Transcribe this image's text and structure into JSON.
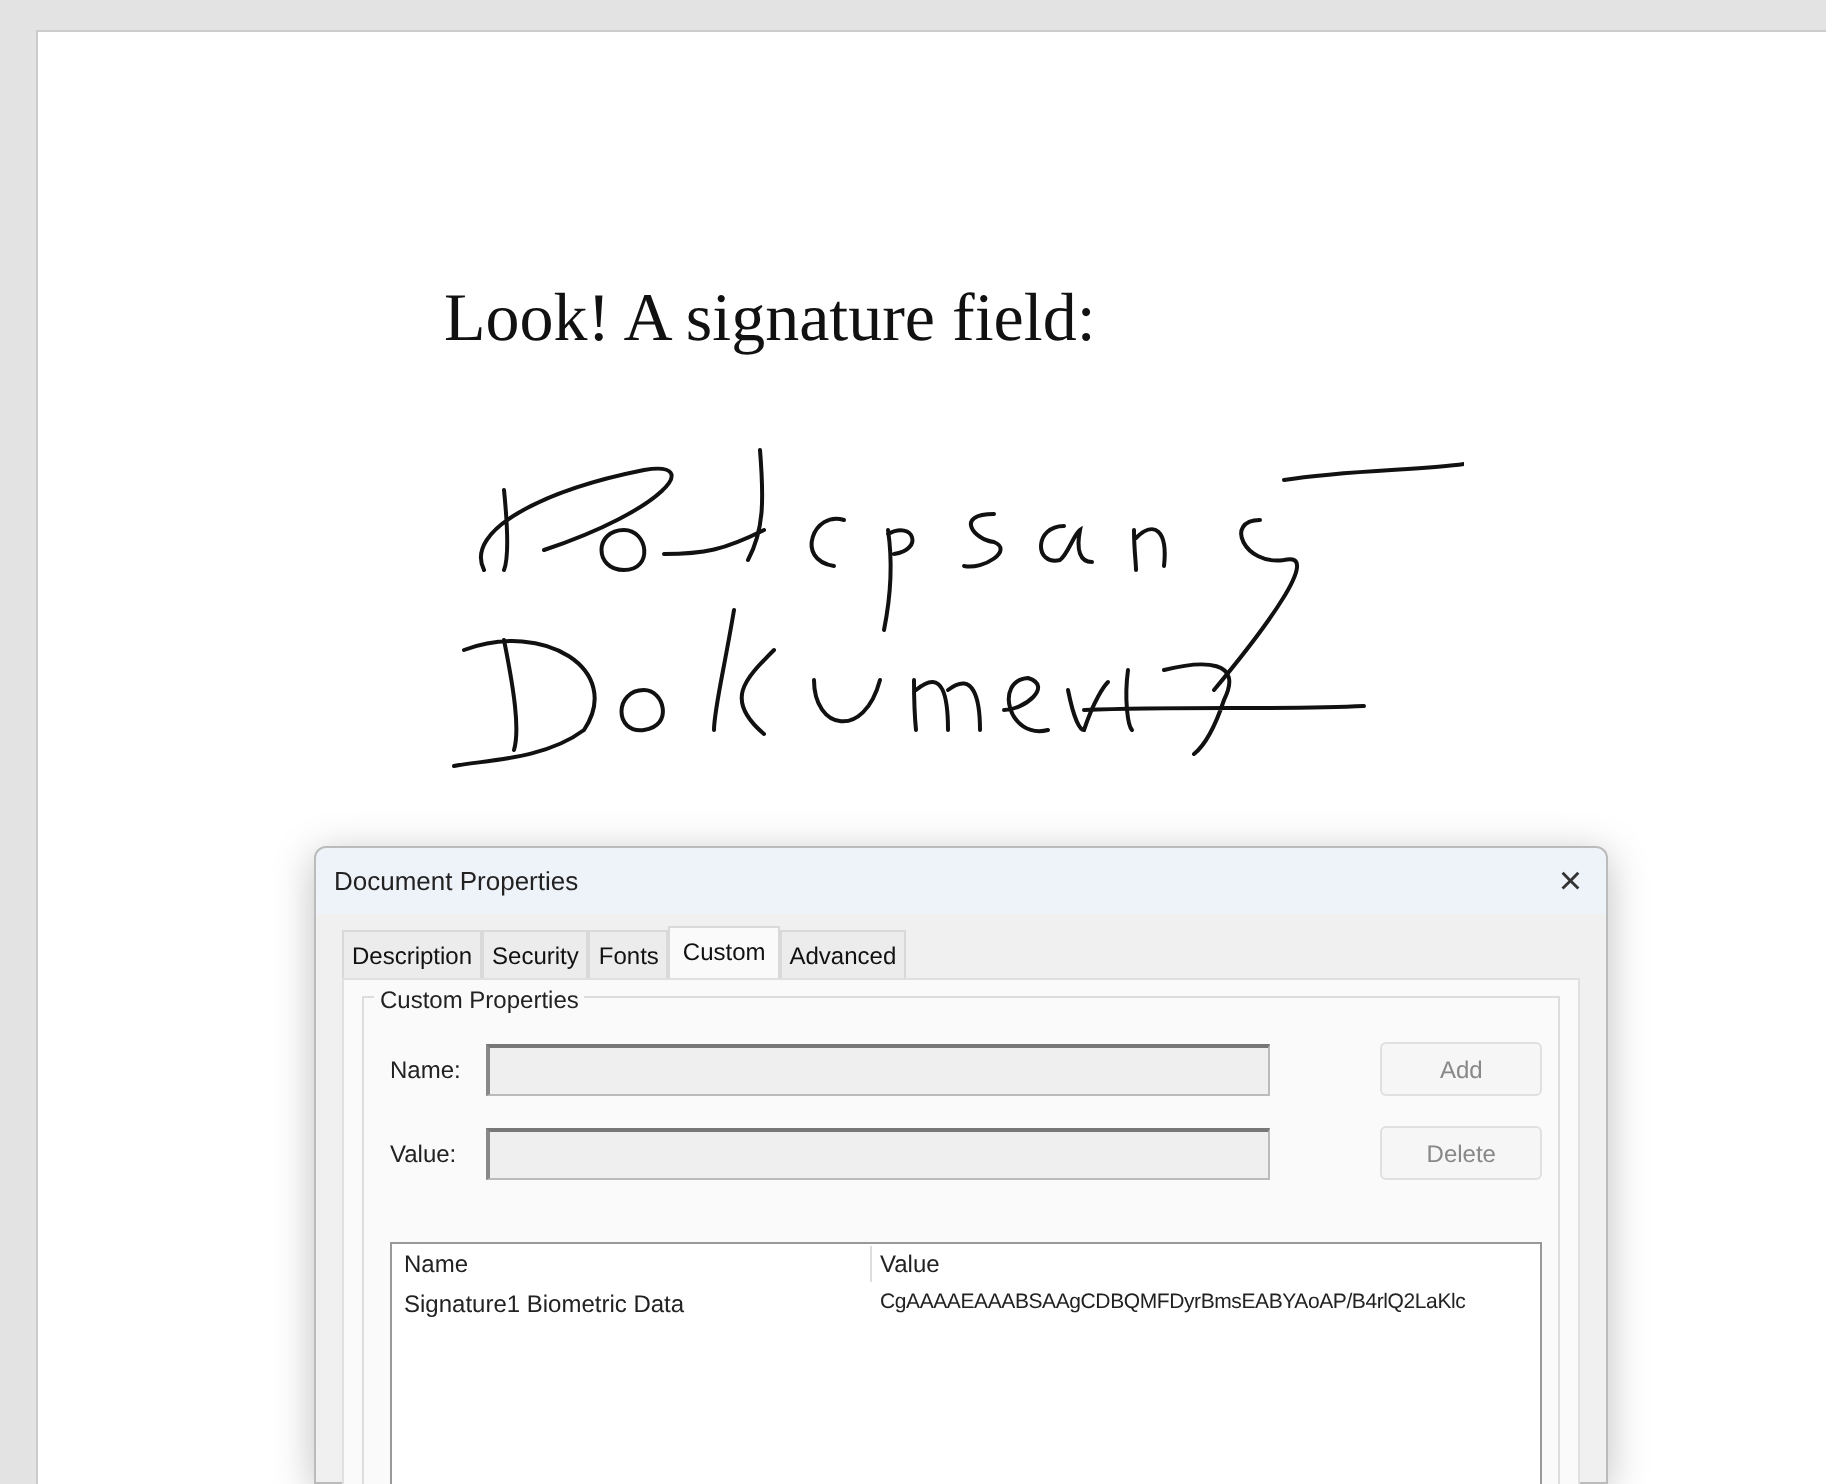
{
  "document": {
    "heading": "Look! A signature field:"
  },
  "dialog": {
    "title": "Document Properties",
    "close": "×",
    "tabs": [
      {
        "label": "Description",
        "selected": false
      },
      {
        "label": "Security",
        "selected": false
      },
      {
        "label": "Fonts",
        "selected": false
      },
      {
        "label": "Custom",
        "selected": true
      },
      {
        "label": "Advanced",
        "selected": false
      }
    ],
    "group_title": "Custom Properties",
    "fields": [
      {
        "label": "Name:",
        "disabled": true,
        "button": {
          "label": "Add",
          "disabled": true
        }
      },
      {
        "label": "Value:",
        "disabled": true,
        "button": {
          "label": "Delete",
          "disabled": true
        }
      }
    ],
    "table": {
      "columns": [
        "Name",
        "Value"
      ],
      "rows": [
        [
          "Signature1 Biometric Data",
          "CgAAAAEAAABSAAgCDBQMFDyrBmsEABYAoAP/B4rlQ2LaKlc"
        ]
      ]
    }
  }
}
